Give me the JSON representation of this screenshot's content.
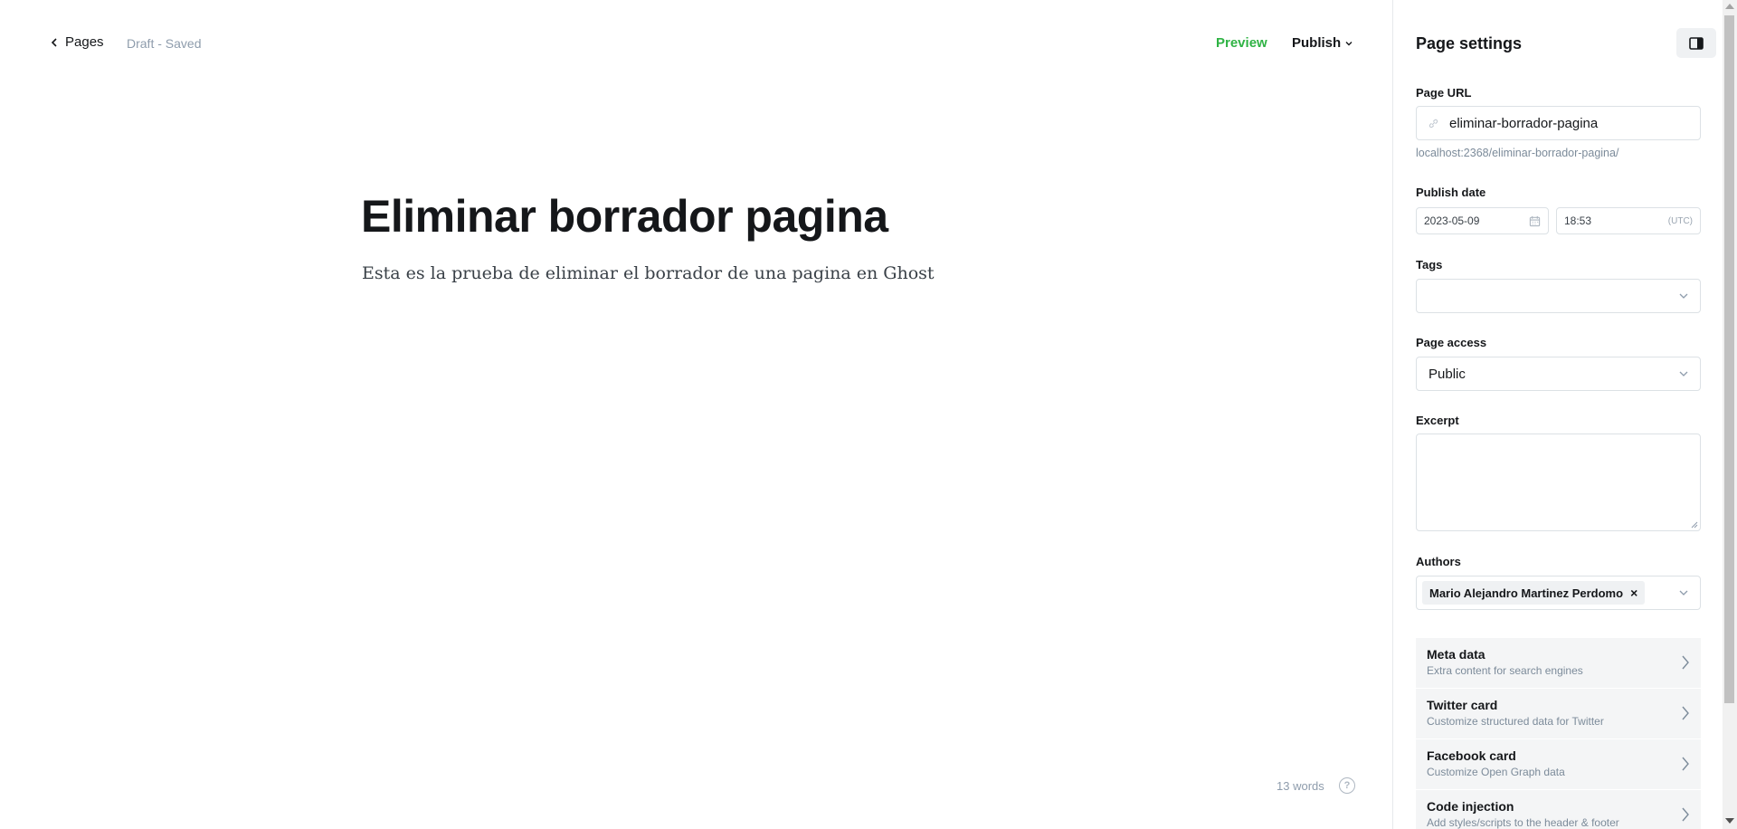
{
  "header": {
    "back_label": "Pages",
    "status": "Draft - Saved",
    "preview_label": "Preview",
    "publish_label": "Publish"
  },
  "editor": {
    "title": "Eliminar borrador pagina",
    "body": "Esta es la prueba de eliminar el borrador de una pagina en Ghost",
    "word_count": "13 words",
    "help_glyph": "?"
  },
  "sidebar": {
    "title": "Page settings",
    "page_url_label": "Page URL",
    "page_url_value": "eliminar-borrador-pagina",
    "page_url_hint": "localhost:2368/eliminar-borrador-pagina/",
    "publish_date_label": "Publish date",
    "publish_date": "2023-05-09",
    "publish_time": "18:53",
    "timezone": "(UTC)",
    "tags_label": "Tags",
    "tags_value": "",
    "access_label": "Page access",
    "access_value": "Public",
    "excerpt_label": "Excerpt",
    "excerpt_value": "",
    "authors_label": "Authors",
    "author_name": "Mario Alejandro Martinez Perdomo",
    "author_remove": "×",
    "sections": [
      {
        "title": "Meta data",
        "subtitle": "Extra content for search engines"
      },
      {
        "title": "Twitter card",
        "subtitle": "Customize structured data for Twitter"
      },
      {
        "title": "Facebook card",
        "subtitle": "Customize Open Graph data"
      },
      {
        "title": "Code injection",
        "subtitle": "Add styles/scripts to the header & footer"
      }
    ]
  },
  "colors": {
    "accent_green": "#2fb344",
    "text_dark": "#15171a",
    "muted": "#8e9cac"
  }
}
